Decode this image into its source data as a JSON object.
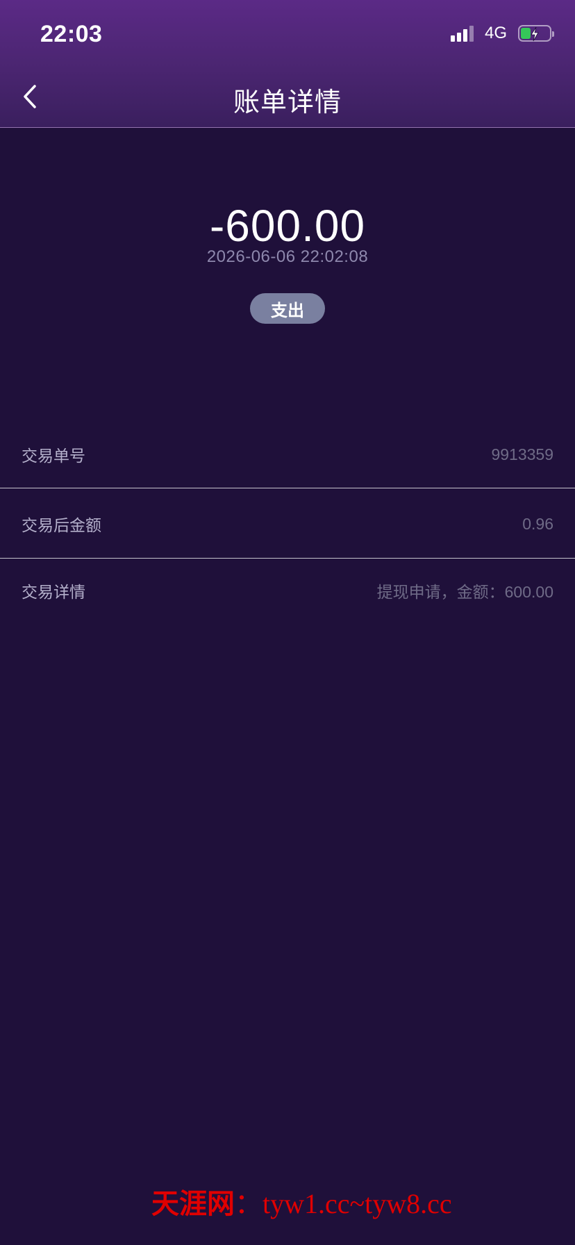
{
  "status_bar": {
    "time": "22:03",
    "network": "4G",
    "battery_color": "#35c759"
  },
  "nav": {
    "back_icon": "chevron-left-icon",
    "title": "账单详情"
  },
  "summary": {
    "amount": "-600.00",
    "datetime": "2026-06-06 22:02:08",
    "type_badge": "支出"
  },
  "details": [
    {
      "label": "交易单号",
      "value": "9913359"
    },
    {
      "label": "交易后金额",
      "value": "0.96"
    },
    {
      "label": "交易详情",
      "value": "提现申请，金额：600.00"
    }
  ],
  "watermark": {
    "text_cn": "天涯网",
    "text_domains": "：tyw1.cc~tyw8.cc"
  },
  "colors": {
    "background": "#1f103a",
    "header_top": "#5b2a86",
    "badge": "#7a80a0",
    "watermark": "#e00000"
  }
}
